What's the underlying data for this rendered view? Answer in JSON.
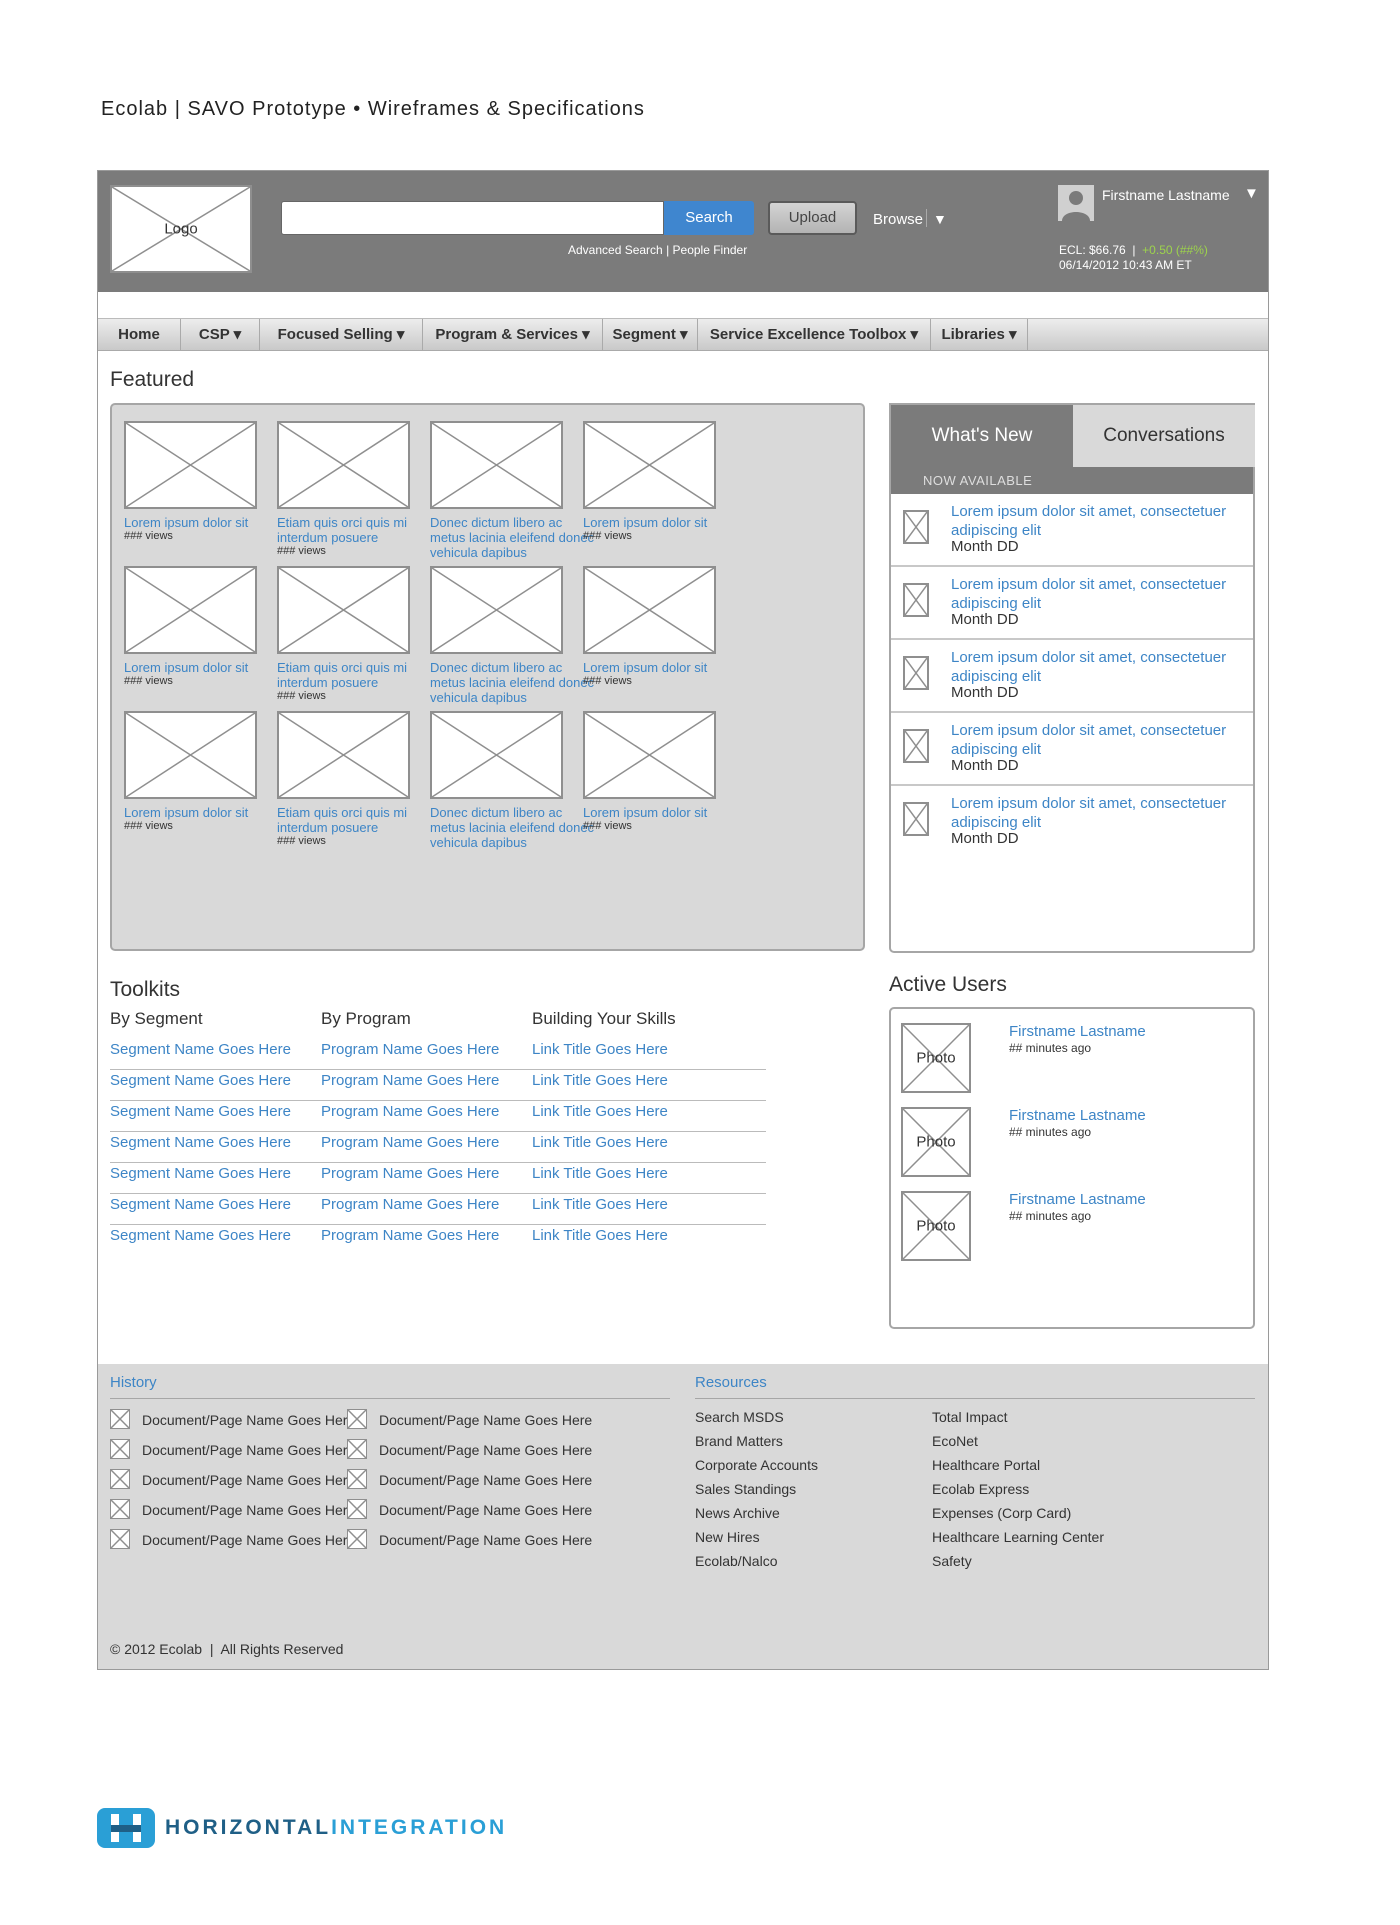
{
  "doc_title": "Ecolab  |  SAVO Prototype  •  Wireframes & Specifications",
  "header": {
    "logo_label": "Logo",
    "search_placeholder": "",
    "search_label": "Search",
    "upload_label": "Upload",
    "browse_label": "Browse",
    "advanced_links": "Advanced Search  |  People Finder",
    "user_name": "Firstname Lastname",
    "stock_price": "ECL: $66.76  |  ",
    "stock_change": "+0.50 (##%)",
    "stock_datetime": "06/14/2012 10:43 AM ET"
  },
  "nav": [
    {
      "label": "Home"
    },
    {
      "label": "CSP ▾"
    },
    {
      "label": "Focused Selling ▾"
    },
    {
      "label": "Program & Services ▾"
    },
    {
      "label": "Segment ▾"
    },
    {
      "label": "Service Excellence Toolbox ▾"
    },
    {
      "label": "Libraries ▾"
    }
  ],
  "featured": {
    "heading": "Featured",
    "items": [
      {
        "title": "Lorem ipsum dolor sit",
        "views": "### views"
      },
      {
        "title": "Etiam quis orci quis mi interdum posuere",
        "views": "### views"
      },
      {
        "title": "Donec dictum libero ac metus lacinia eleifend donec vehicula dapibus",
        "views": ""
      },
      {
        "title": "Lorem ipsum dolor sit",
        "views": "### views"
      },
      {
        "title": "Lorem ipsum dolor sit",
        "views": "### views"
      },
      {
        "title": "Etiam quis orci quis mi interdum posuere",
        "views": "### views"
      },
      {
        "title": "Donec dictum libero ac metus lacinia eleifend donec vehicula dapibus",
        "views": ""
      },
      {
        "title": "Lorem ipsum dolor sit",
        "views": "### views"
      },
      {
        "title": "Lorem ipsum dolor sit",
        "views": "### views"
      },
      {
        "title": "Etiam quis orci quis mi interdum posuere",
        "views": "### views"
      },
      {
        "title": "Donec dictum libero ac metus lacinia eleifend donec vehicula dapibus",
        "views": ""
      },
      {
        "title": "Lorem ipsum dolor sit",
        "views": "### views"
      }
    ]
  },
  "tabs": {
    "active": "What's New",
    "inactive": "Conversations",
    "subheader": "NOW AVAILABLE",
    "items": [
      {
        "title": "Lorem ipsum dolor sit amet, consectetuer adipiscing elit",
        "date": "Month DD"
      },
      {
        "title": "Lorem ipsum dolor sit amet, consectetuer adipiscing elit",
        "date": "Month DD"
      },
      {
        "title": "Lorem ipsum dolor sit amet, consectetuer adipiscing elit",
        "date": "Month DD"
      },
      {
        "title": "Lorem ipsum dolor sit amet, consectetuer adipiscing elit",
        "date": "Month DD"
      },
      {
        "title": "Lorem ipsum dolor sit amet, consectetuer adipiscing elit",
        "date": "Month DD"
      }
    ]
  },
  "toolkits": {
    "heading": "Toolkits",
    "columns": [
      {
        "heading": "By Segment",
        "links": [
          "Segment Name Goes Here",
          "Segment Name Goes Here",
          "Segment Name Goes Here",
          "Segment Name Goes Here",
          "Segment Name Goes Here",
          "Segment Name Goes Here",
          "Segment Name Goes Here"
        ]
      },
      {
        "heading": "By Program",
        "links": [
          "Program Name Goes Here",
          "Program Name Goes Here",
          "Program Name Goes Here",
          "Program Name Goes Here",
          "Program Name Goes Here",
          "Program Name Goes Here",
          "Program Name Goes Here"
        ]
      },
      {
        "heading": "Building Your Skills",
        "links": [
          "Link Title Goes Here",
          "Link Title Goes Here",
          "Link Title Goes Here",
          "Link Title Goes Here",
          "Link Title Goes Here",
          "Link Title Goes Here",
          "Link Title Goes Here"
        ]
      }
    ]
  },
  "active_users": {
    "heading": "Active Users",
    "users": [
      {
        "photo": "Photo",
        "name": "Firstname Lastname",
        "time": "## minutes ago"
      },
      {
        "photo": "Photo",
        "name": "Firstname Lastname",
        "time": "## minutes ago"
      },
      {
        "photo": "Photo",
        "name": "Firstname Lastname",
        "time": "## minutes ago"
      }
    ]
  },
  "footer": {
    "history_heading": "History",
    "history_items": [
      "Document/Page Name Goes Here",
      "Document/Page Name Goes Here",
      "Document/Page Name Goes Here",
      "Document/Page Name Goes Here",
      "Document/Page Name Goes Here",
      "Document/Page Name Goes Here",
      "Document/Page Name Goes Here",
      "Document/Page Name Goes Here",
      "Document/Page Name Goes Here",
      "Document/Page Name Goes Here"
    ],
    "resources_heading": "Resources",
    "resources_col1": [
      "Search MSDS",
      "Brand Matters",
      "Corporate Accounts",
      "Sales Standings",
      "News Archive",
      "New Hires",
      "Ecolab/Nalco"
    ],
    "resources_col2": [
      "Total Impact",
      "EcoNet",
      "Healthcare Portal",
      "Ecolab Express",
      "Expenses (Corp Card)",
      "Healthcare Learning Center",
      "Safety"
    ],
    "copyright": "© 2012 Ecolab  |  All Rights Reserved"
  },
  "brand": {
    "part1": "HORIZONTAL",
    "part2": "INTEGRATION"
  }
}
